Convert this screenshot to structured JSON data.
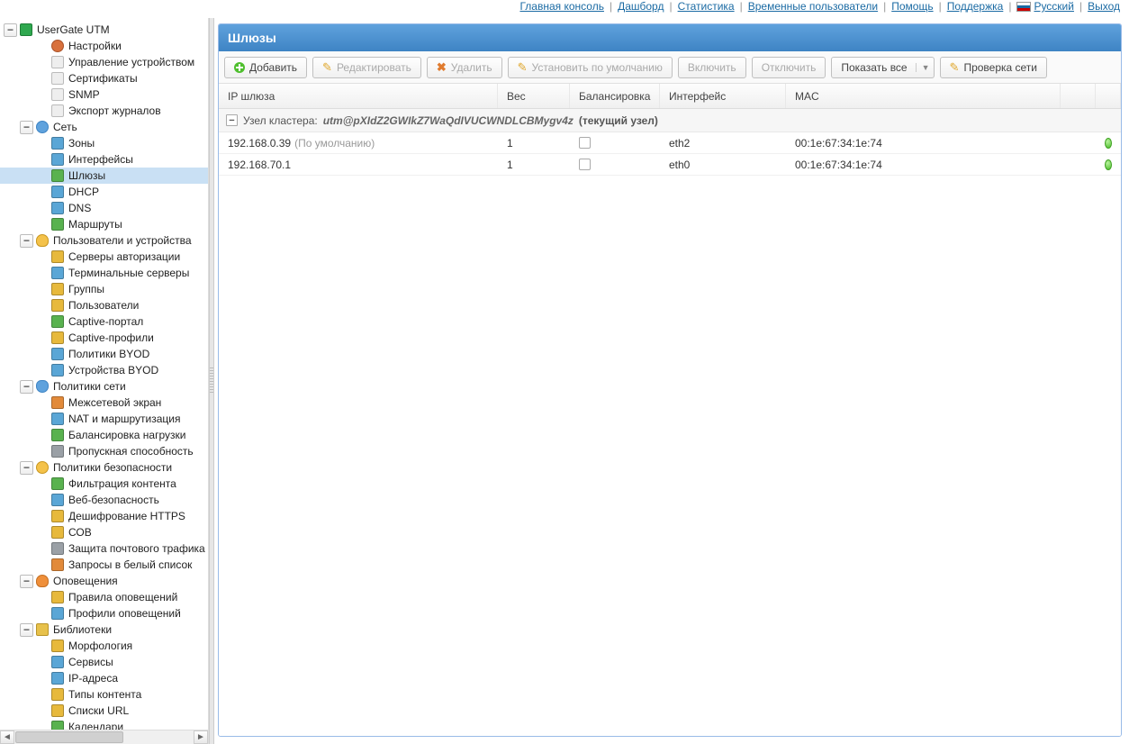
{
  "top_nav": {
    "main_console": "Главная консоль",
    "dashboard": "Дашборд",
    "statistics": "Статистика",
    "temp_users": "Временные пользователи",
    "help": "Помощь",
    "support": "Поддержка",
    "lang": "Русский",
    "logout": "Выход"
  },
  "tree": {
    "root": "UserGate UTM",
    "groups": [
      {
        "label": "UserGate UTM",
        "icon": "root",
        "indent": 0,
        "expanded": true
      },
      {
        "label": "Настройки",
        "icon": "gear",
        "indent": 2
      },
      {
        "label": "Управление устройством",
        "icon": "page",
        "indent": 2
      },
      {
        "label": "Сертификаты",
        "icon": "page",
        "indent": 2
      },
      {
        "label": "SNMP",
        "icon": "page",
        "indent": 2
      },
      {
        "label": "Экспорт журналов",
        "icon": "page",
        "indent": 2
      },
      {
        "label": "Сеть",
        "icon": "net",
        "indent": 1,
        "expanded": true
      },
      {
        "label": "Зоны",
        "icon": "leaf-blue",
        "indent": 2
      },
      {
        "label": "Интерфейсы",
        "icon": "leaf-blue",
        "indent": 2
      },
      {
        "label": "Шлюзы",
        "icon": "leaf-green",
        "indent": 2,
        "selected": true
      },
      {
        "label": "DHCP",
        "icon": "leaf-blue",
        "indent": 2
      },
      {
        "label": "DNS",
        "icon": "leaf-blue",
        "indent": 2
      },
      {
        "label": "Маршруты",
        "icon": "leaf-green",
        "indent": 2
      },
      {
        "label": "Пользователи и устройства",
        "icon": "person",
        "indent": 1,
        "expanded": true
      },
      {
        "label": "Серверы авторизации",
        "icon": "leaf-yellow",
        "indent": 2
      },
      {
        "label": "Терминальные серверы",
        "icon": "leaf-blue",
        "indent": 2
      },
      {
        "label": "Группы",
        "icon": "leaf-yellow",
        "indent": 2
      },
      {
        "label": "Пользователи",
        "icon": "leaf-yellow",
        "indent": 2
      },
      {
        "label": "Captive-портал",
        "icon": "leaf-green",
        "indent": 2
      },
      {
        "label": "Captive-профили",
        "icon": "leaf-yellow",
        "indent": 2
      },
      {
        "label": "Политики BYOD",
        "icon": "leaf-blue",
        "indent": 2
      },
      {
        "label": "Устройства BYOD",
        "icon": "leaf-blue",
        "indent": 2
      },
      {
        "label": "Политики сети",
        "icon": "shield",
        "indent": 1,
        "expanded": true
      },
      {
        "label": "Межсетевой экран",
        "icon": "leaf-orange",
        "indent": 2
      },
      {
        "label": "NAT и маршрутизация",
        "icon": "leaf-blue",
        "indent": 2
      },
      {
        "label": "Балансировка нагрузки",
        "icon": "leaf-green",
        "indent": 2
      },
      {
        "label": "Пропускная способность",
        "icon": "leaf-gray",
        "indent": 2
      },
      {
        "label": "Политики безопасности",
        "icon": "sec",
        "indent": 1,
        "expanded": true
      },
      {
        "label": "Фильтрация контента",
        "icon": "leaf-green",
        "indent": 2
      },
      {
        "label": "Веб-безопасность",
        "icon": "leaf-blue",
        "indent": 2
      },
      {
        "label": "Дешифрование HTTPS",
        "icon": "leaf-yellow",
        "indent": 2
      },
      {
        "label": "СОВ",
        "icon": "leaf-yellow",
        "indent": 2
      },
      {
        "label": "Защита почтового трафика",
        "icon": "leaf-gray",
        "indent": 2
      },
      {
        "label": "Запросы в белый список",
        "icon": "leaf-orange",
        "indent": 2
      },
      {
        "label": "Оповещения",
        "icon": "bell",
        "indent": 1,
        "expanded": true
      },
      {
        "label": "Правила оповещений",
        "icon": "leaf-yellow",
        "indent": 2
      },
      {
        "label": "Профили оповещений",
        "icon": "leaf-blue",
        "indent": 2
      },
      {
        "label": "Библиотеки",
        "icon": "lib",
        "indent": 1,
        "expanded": true
      },
      {
        "label": "Морфология",
        "icon": "leaf-yellow",
        "indent": 2
      },
      {
        "label": "Сервисы",
        "icon": "leaf-blue",
        "indent": 2
      },
      {
        "label": "IP-адреса",
        "icon": "leaf-blue",
        "indent": 2
      },
      {
        "label": "Типы контента",
        "icon": "leaf-yellow",
        "indent": 2
      },
      {
        "label": "Списки URL",
        "icon": "leaf-yellow",
        "indent": 2
      },
      {
        "label": "Календари",
        "icon": "leaf-green",
        "indent": 2
      }
    ]
  },
  "panel": {
    "title": "Шлюзы"
  },
  "toolbar": {
    "add": "Добавить",
    "edit": "Редактировать",
    "delete": "Удалить",
    "set_default": "Установить по умолчанию",
    "enable": "Включить",
    "disable": "Отключить",
    "show_all": "Показать все",
    "net_check": "Проверка сети"
  },
  "grid": {
    "cols": {
      "ip": "IP шлюза",
      "weight": "Вес",
      "balancing": "Балансировка",
      "interface": "Интерфейс",
      "mac": "MAC"
    },
    "group": {
      "prefix": "Узел кластера:",
      "name": "utm@pXIdZ2GWIkZ7WaQdIVUCWNDLCBMygv4z",
      "suffix": "(текущий узел)"
    },
    "rows": [
      {
        "ip": "192.168.0.39",
        "default": "(По умолчанию)",
        "weight": "1",
        "balancing": false,
        "interface": "eth2",
        "mac": "00:1e:67:34:1e:74",
        "status": "green"
      },
      {
        "ip": "192.168.70.1",
        "default": "",
        "weight": "1",
        "balancing": false,
        "interface": "eth0",
        "mac": "00:1e:67:34:1e:74",
        "status": "green"
      }
    ]
  }
}
